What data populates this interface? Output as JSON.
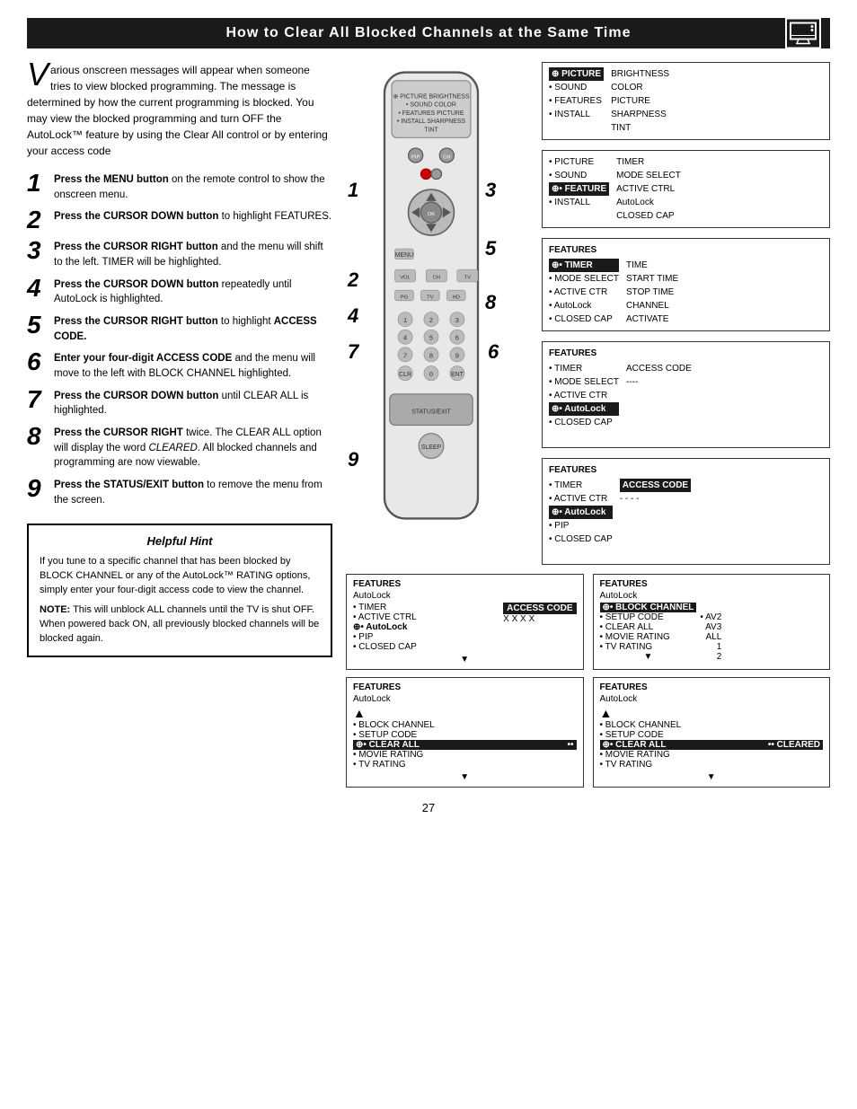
{
  "header": {
    "title": "How to Clear All Blocked Channels at the Same Time"
  },
  "intro": {
    "drop_cap": "V",
    "text": "arious onscreen messages will appear when someone tries to view blocked programming. The message is determined by how the current programming is blocked. You may view the blocked programming and turn OFF the AutoLock™ feature by using the Clear All control or by entering your access code"
  },
  "steps": [
    {
      "number": "1",
      "text_bold": "Press the MENU button",
      "text_rest": " on the remote control to show the onscreen menu."
    },
    {
      "number": "2",
      "text_bold": "Press the CURSOR DOWN button",
      "text_rest": " to highlight FEATURES."
    },
    {
      "number": "3",
      "text_bold": "Press the CURSOR RIGHT button",
      "text_rest": " and the menu will shift to the left. TIMER will be highlighted."
    },
    {
      "number": "4",
      "text_bold": "Press the CURSOR DOWN button",
      "text_rest": " repeatedly until AutoLock is highlighted."
    },
    {
      "number": "5",
      "text_bold": "Press the CURSOR RIGHT button",
      "text_rest": " to highlight ACCESS CODE."
    },
    {
      "number": "6",
      "text_bold": "Enter your four-digit ACCESS CODE",
      "text_rest": " and the menu will move to the left with BLOCK CHANNEL highlighted."
    },
    {
      "number": "7",
      "text_bold": "Press the CURSOR DOWN button",
      "text_rest": " until CLEAR ALL is highlighted."
    },
    {
      "number": "8",
      "text_bold": "Press the CURSOR RIGHT",
      "text_rest": " twice. The CLEAR ALL option will display the word CLEARED. All blocked channels and programming are now viewable."
    },
    {
      "number": "9",
      "text_bold": "Press the STATUS/EXIT button",
      "text_rest": " to remove the menu from the screen."
    }
  ],
  "helpful_hint": {
    "title": "Helpful Hint",
    "p1": "If you tune to a specific channel that has been blocked by BLOCK CHANNEL or any of the AutoLock™ RATING options, simply enter your four-digit access code to view the channel.",
    "p2_note": "NOTE:",
    "p2": " This will unblock ALL channels until the TV is shut OFF. When powered back ON, all previously blocked channels will be blocked again."
  },
  "page_number": "27",
  "menus": {
    "menu1": {
      "title": "PICTURE",
      "items_left": [
        "• SOUND",
        "• FEATURES",
        "• INSTALL"
      ],
      "items_right": [
        "BRIGHTNESS",
        "COLOR",
        "PICTURE",
        "SHARPNESS",
        "TINT"
      ]
    },
    "menu2": {
      "items_left": [
        "• PICTURE",
        "• SOUND",
        "⊕• FEATURE",
        "• INSTALL"
      ],
      "items_right": [
        "TIMER",
        "MODE SELECT",
        "ACTIVE CTRL",
        "AutoLock",
        "CLOSED CAP"
      ],
      "highlighted_left": "⊕• FEATURE"
    },
    "menu3": {
      "title": "FEATURES",
      "items_left": [
        "⊕• TIMER",
        "• MODE SELECT",
        "• ACTIVE CTR",
        "• AutoLock",
        "• CLOSED CAP"
      ],
      "items_right": [
        "TIME",
        "START TIME",
        "STOP TIME",
        "CHANNEL",
        "ACTIVATE"
      ],
      "highlighted_left": "⊕• TIMER"
    },
    "menu4": {
      "title": "FEATURES",
      "items_left": [
        "• TIMER",
        "• MODE SELECT",
        "• ACTIVE CTR",
        "⊕• AutoLock",
        "• CLOSED CAP"
      ],
      "items_right": [
        "ACCESS CODE",
        "----"
      ],
      "highlighted_left": "⊕• AutoLock",
      "access_code_label": "ACCESS CODE",
      "access_code_value": "----"
    },
    "menu5": {
      "title": "FEATURES",
      "items_left": [
        "• TIMER",
        "• ACTIVE CTR",
        "⊕• AutoLock",
        "• PIP",
        "• CLOSED CAP"
      ],
      "highlighted_access": "ACCESS CODE",
      "dashes": "- - - -"
    },
    "menu6_left": {
      "title": "FEATURES",
      "subtitle": "AutoLock",
      "items_left": [
        "• TIMER",
        "• ACTIVE CTRL",
        "⊕• AutoLock",
        "• PIP",
        "• CLOSED CAP"
      ],
      "access_code": "X X X X"
    },
    "menu7_right": {
      "title": "FEATURES",
      "subtitle": "AutoLock",
      "items_left": [
        "⊕• BLOCK CHANNEL",
        "• AV2",
        "• SETUP CODE",
        "AV3",
        "• CLEAR ALL",
        "ALL",
        "• MOVIE RATING",
        "1",
        "• TV RATING",
        "2"
      ],
      "highlighted": "⊕• BLOCK CHANNEL"
    },
    "menu8_left": {
      "title": "FEATURES",
      "subtitle": "AutoLock",
      "items": [
        "• BLOCK CHANNEL",
        "• SETUP CODE",
        "⊕• CLEAR ALL",
        "• MOVIE RATING",
        "• TV RATING"
      ],
      "highlighted": "⊕• CLEAR ALL",
      "arrow_right": "••"
    },
    "menu8_right": {
      "title": "FEATURES",
      "subtitle": "AutoLock",
      "items": [
        "• BLOCK CHANNEL",
        "• SETUP CODE",
        "⊕• CLEAR ALL",
        "• MOVIE RATING",
        "• TV RATING"
      ],
      "highlighted": "⊕• CLEAR ALL",
      "cleared": "CLEARED"
    }
  }
}
